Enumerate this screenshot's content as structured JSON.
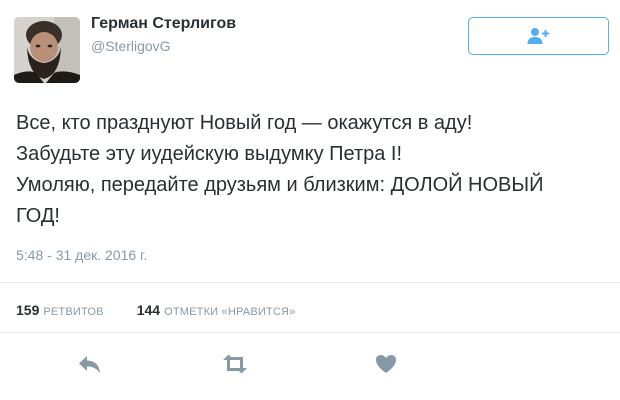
{
  "author": {
    "name": "Герман Стерлигов",
    "handle": "@SterligovG"
  },
  "follow_button": {
    "icon": "follow-user-plus-icon",
    "color": "#55acee"
  },
  "tweet": {
    "lines": [
      "Все, кто празднуют Новый год — окажутся в аду!",
      "Забудьте эту иудейскую выдумку Петра I!",
      "Умоляю, передайте друзьям и близким: ДОЛОЙ НОВЫЙ",
      "ГОД!"
    ],
    "timestamp": "5:48 - 31 дек. 2016 г."
  },
  "stats": {
    "retweets_count": "159",
    "retweets_label": "РЕТВИТОВ",
    "likes_count": "144",
    "likes_label": "ОТМЕТКИ «НРАВИТСЯ»"
  },
  "actions": {
    "reply_icon": "reply-icon",
    "retweet_icon": "retweet-icon",
    "like_icon": "heart-icon",
    "icon_color": "#8899a6"
  }
}
